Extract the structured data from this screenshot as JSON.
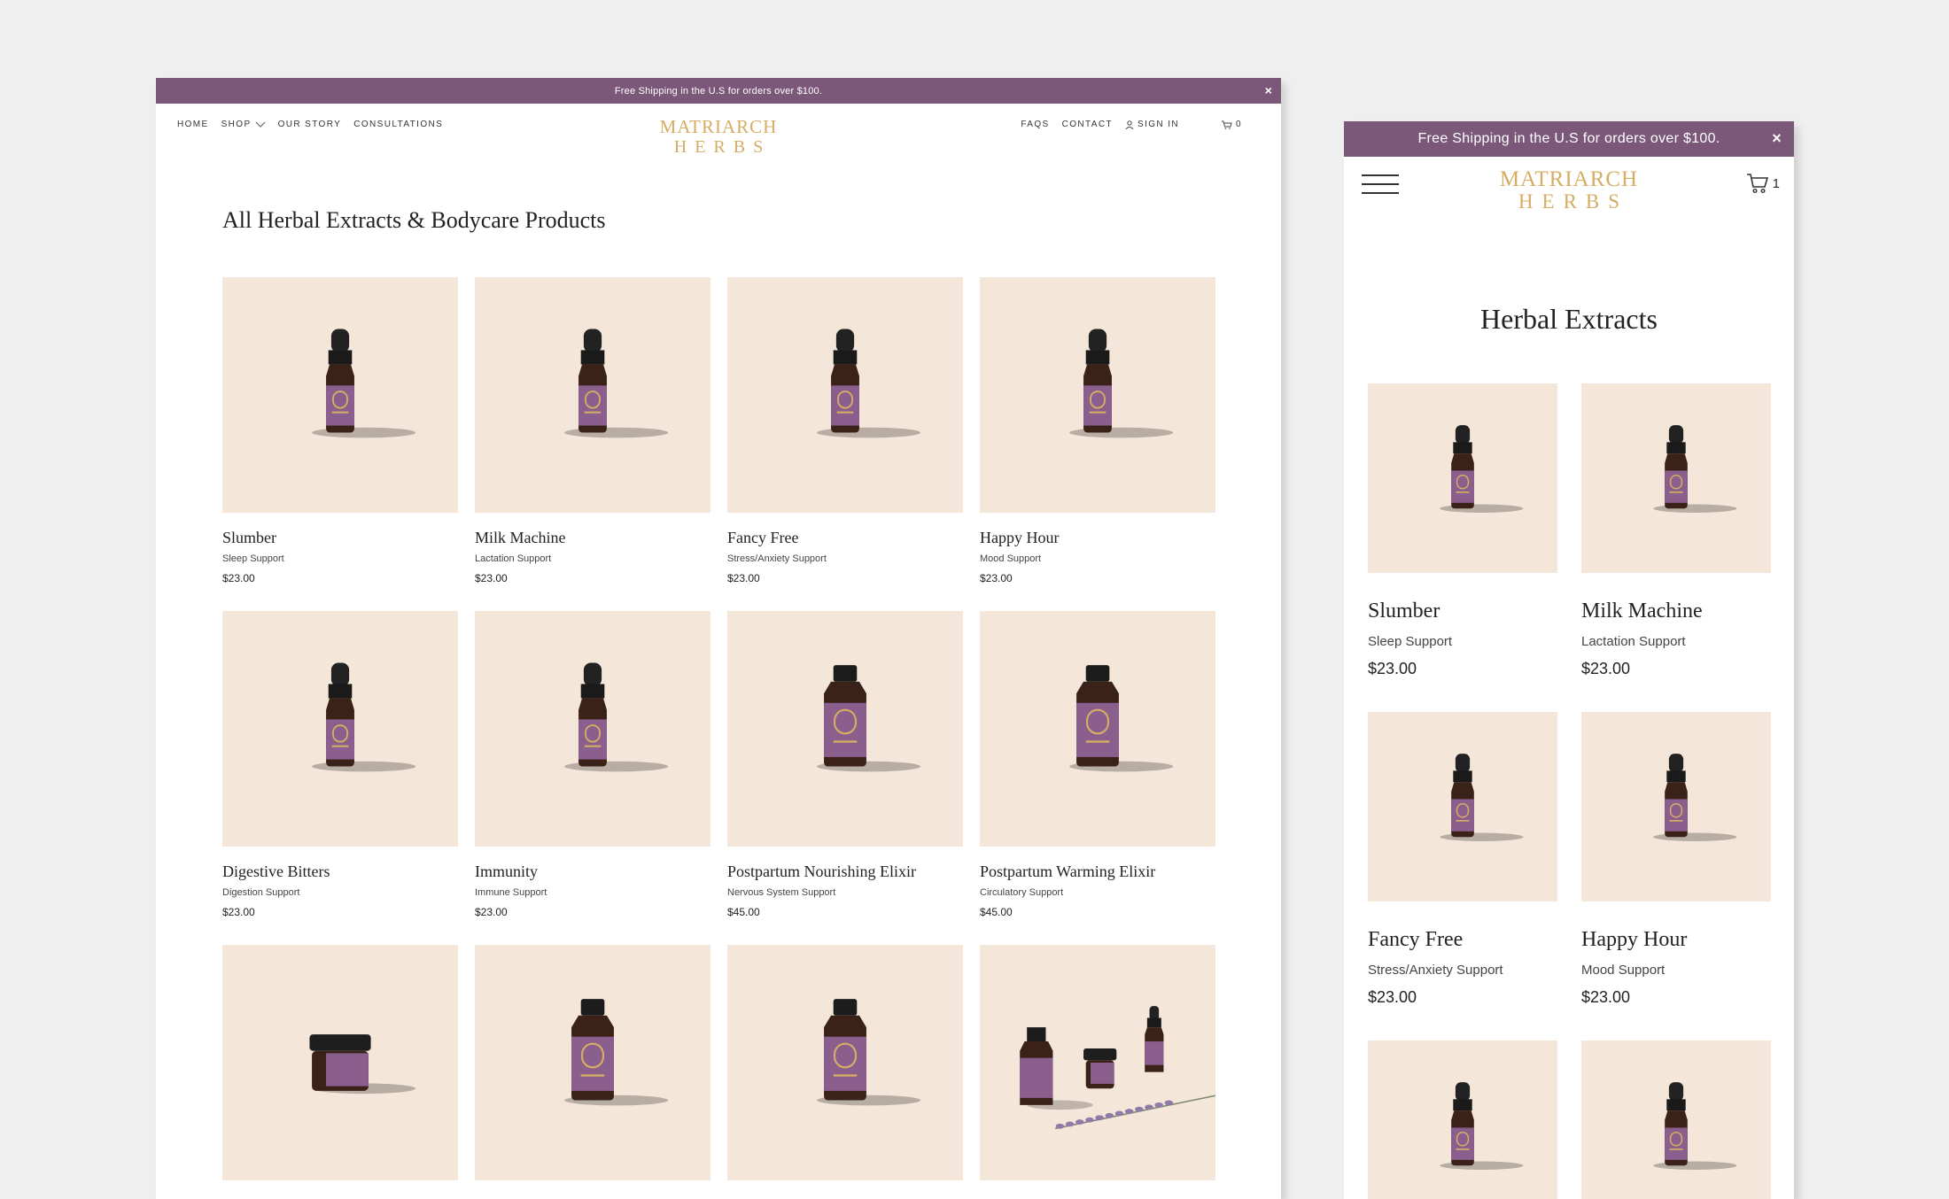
{
  "desktop": {
    "promo": "Free Shipping in the U.S for orders over $100.",
    "close": "×",
    "nav_left": [
      "HOME",
      "SHOP",
      "OUR STORY",
      "CONSULTATIONS"
    ],
    "nav_right": {
      "faqs": "FAQS",
      "contact": "CONTACT",
      "sign_in": "SIGN IN",
      "cart_count": "0"
    },
    "logo": {
      "line1": "MATRIARCH",
      "line2": "HERBS"
    },
    "title": "All Herbal Extracts & Bodycare Products",
    "products": [
      {
        "name": "Slumber",
        "sub": "Sleep Support",
        "price": "$23.00",
        "image": "dropper-bottle"
      },
      {
        "name": "Milk Machine",
        "sub": "Lactation Support",
        "price": "$23.00",
        "image": "dropper-bottle"
      },
      {
        "name": "Fancy Free",
        "sub": "Stress/Anxiety Support",
        "price": "$23.00",
        "image": "dropper-bottle"
      },
      {
        "name": "Happy Hour",
        "sub": "Mood Support",
        "price": "$23.00",
        "image": "dropper-bottle"
      },
      {
        "name": "Digestive Bitters",
        "sub": "Digestion Support",
        "price": "$23.00",
        "image": "dropper-bottle"
      },
      {
        "name": "Immunity",
        "sub": "Immune Support",
        "price": "$23.00",
        "image": "dropper-bottle"
      },
      {
        "name": "Postpartum Nourishing Elixir",
        "sub": "Nervous System Support",
        "price": "$45.00",
        "image": "wide-bottle"
      },
      {
        "name": "Postpartum Warming Elixir",
        "sub": "Circulatory Support",
        "price": "$45.00",
        "image": "wide-bottle"
      },
      {
        "name": "",
        "sub": "",
        "price": "",
        "image": "jar"
      },
      {
        "name": "",
        "sub": "",
        "price": "",
        "image": "wide-bottle"
      },
      {
        "name": "",
        "sub": "",
        "price": "",
        "image": "wide-bottle"
      },
      {
        "name": "",
        "sub": "",
        "price": "",
        "image": "bundle"
      }
    ]
  },
  "mobile": {
    "promo": "Free Shipping in the U.S for orders over $100.",
    "close": "×",
    "logo": {
      "line1": "MATRIARCH",
      "line2": "HERBS"
    },
    "cart_count": "1",
    "title": "Herbal Extracts",
    "products": [
      {
        "name": "Slumber",
        "sub": "Sleep Support",
        "price": "$23.00",
        "image": "dropper-bottle"
      },
      {
        "name": "Milk Machine",
        "sub": "Lactation Support",
        "price": "$23.00",
        "image": "dropper-bottle"
      },
      {
        "name": "Fancy Free",
        "sub": "Stress/Anxiety Support",
        "price": "$23.00",
        "image": "dropper-bottle"
      },
      {
        "name": "Happy Hour",
        "sub": "Mood Support",
        "price": "$23.00",
        "image": "dropper-bottle"
      },
      {
        "name": "",
        "sub": "",
        "price": "",
        "image": "dropper-bottle"
      },
      {
        "name": "",
        "sub": "",
        "price": "",
        "image": "dropper-bottle"
      }
    ]
  },
  "colors": {
    "promo_bar": "#7b5879",
    "logo_gold": "#d5ad63",
    "tile_bg": "#f4e7d9",
    "label_purple": "#8a5f8e",
    "glass_brown": "#3b2219"
  }
}
